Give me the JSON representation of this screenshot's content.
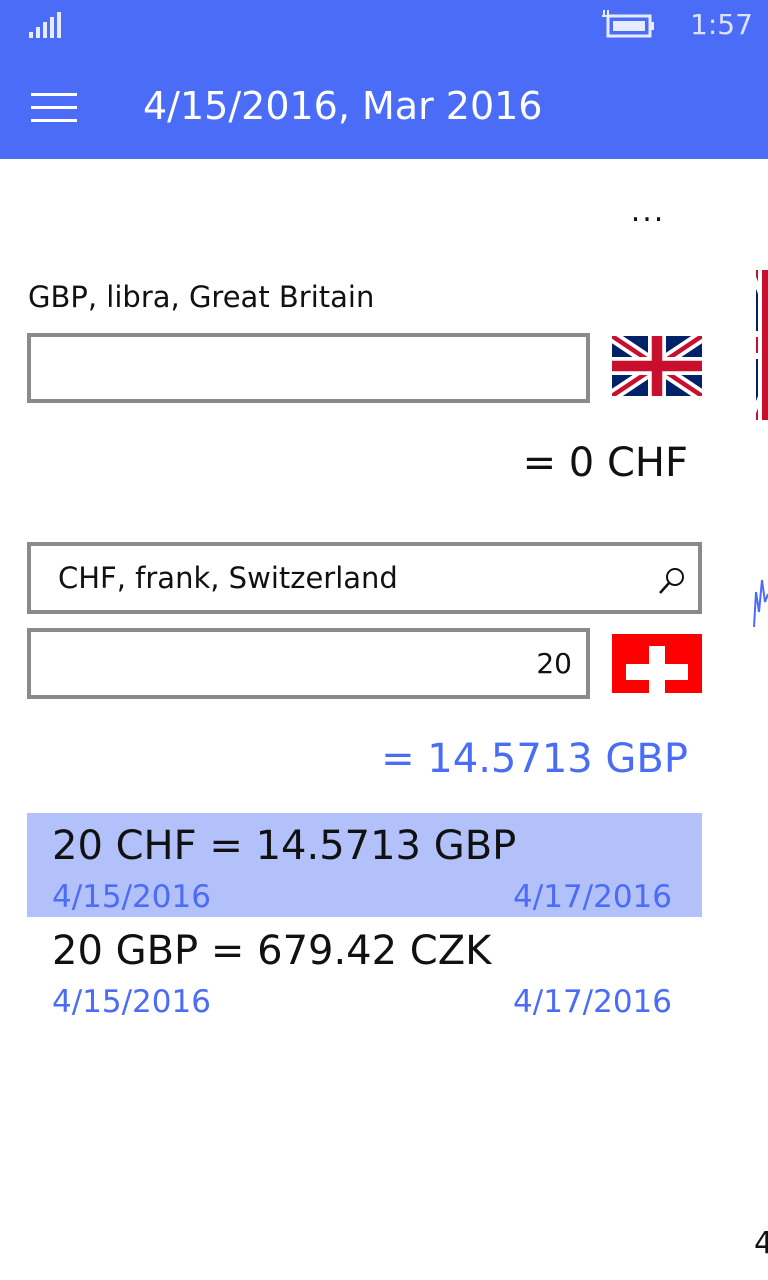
{
  "status_bar": {
    "time": "1:57",
    "signal_icon": "signal-strength-icon",
    "battery_icon": "battery-charging-icon"
  },
  "header": {
    "menu_icon": "hamburger-menu-icon",
    "title": "4/15/2016, Mar 2016",
    "background_color": "#4a6cf7"
  },
  "overflow_menu": {
    "label": "..."
  },
  "source": {
    "currency_label": "GBP, libra, Great Britain",
    "amount_value": "",
    "flag": "uk-flag",
    "result": "= 0 CHF"
  },
  "target": {
    "currency_search_value": "CHF, frank, Switzerland",
    "search_icon": "search-icon",
    "amount_value": "20",
    "flag": "switzerland-flag",
    "result": "= 14.5713 GBP",
    "result_color": "#4a6cf7"
  },
  "history": [
    {
      "conversion": "20 CHF = 14.5713 GBP",
      "date_left": "4/15/2016",
      "date_right": "4/17/2016",
      "selected": true
    },
    {
      "conversion": "20 GBP = 679.42 CZK",
      "date_left": "4/15/2016",
      "date_right": "4/17/2016",
      "selected": false
    }
  ],
  "peek_page": {
    "text": "4"
  },
  "colors": {
    "accent": "#4a6cf7",
    "selection": "#b3c1fa",
    "border": "#8a8a8a"
  }
}
